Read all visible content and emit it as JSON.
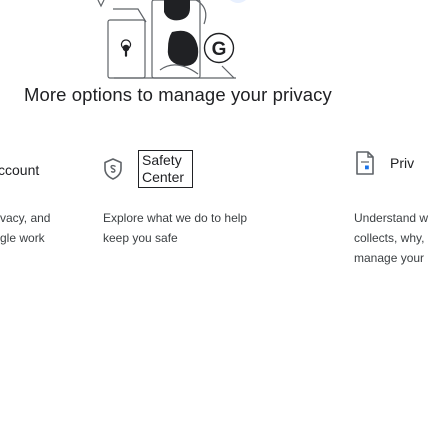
{
  "section_title": "More options to manage your privacy",
  "cards": [
    {
      "label": "ccount",
      "desc_lines": [
        "vacy, and",
        "gle work"
      ]
    },
    {
      "label": "Safety Center",
      "icon": "shield-icon",
      "desc_lines": [
        "Explore what we do to help",
        "keep you safe"
      ]
    },
    {
      "label": "Priv",
      "icon": "document-icon",
      "desc_lines": [
        "Understand w",
        "collects, why,",
        "manage your"
      ]
    }
  ],
  "colors": {
    "text": "#202124",
    "secondary_text": "#3c4043",
    "icon_stroke": "#5f6368",
    "accent_blue": "#1a73e8"
  }
}
